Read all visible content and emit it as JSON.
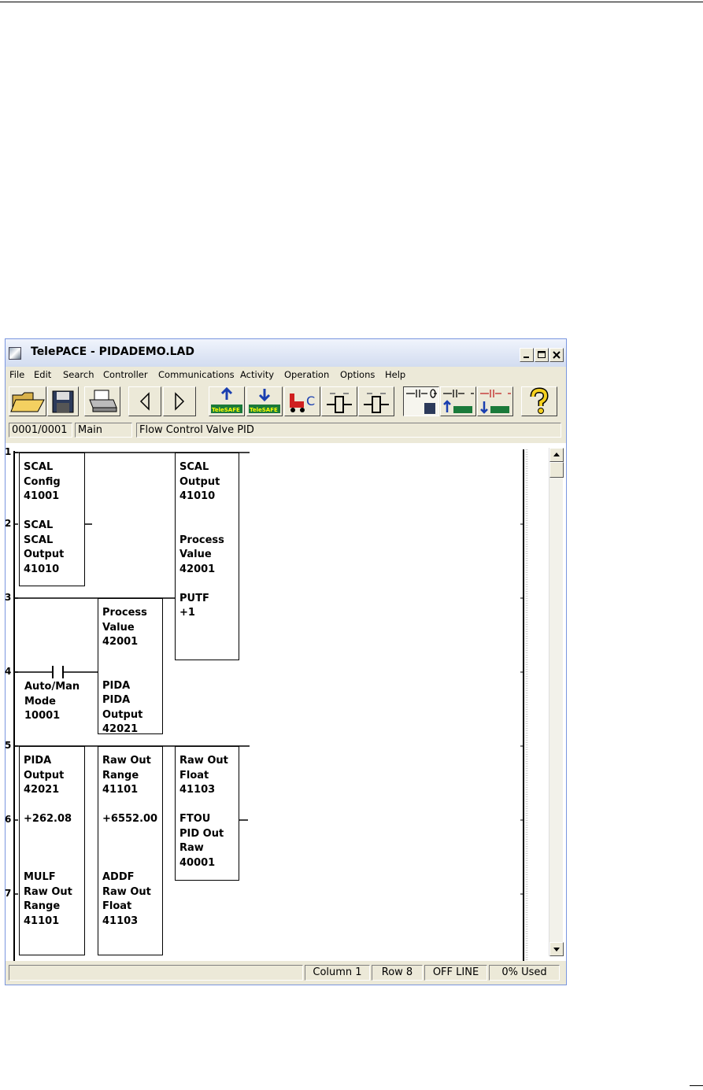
{
  "window": {
    "title": "TelePACE - PIDADEMO.LAD"
  },
  "menu": [
    "File",
    "Edit",
    "Search",
    "Controller",
    "Communications",
    "Activity",
    "Operation",
    "Options",
    "Help"
  ],
  "toolbar": {
    "telesafe_label": "TeleSAFE",
    "icons": [
      "open-folder-icon",
      "save-disk-icon",
      "print-icon",
      "back-arrow-icon",
      "forward-arrow-icon",
      "read-from-controller-icon",
      "write-to-controller-icon",
      "run-controller-icon",
      "monitor-icon",
      "monitor-alt-icon",
      "ladder-save-icon",
      "ladder-read-icon",
      "ladder-write-icon",
      "help-icon"
    ],
    "controller_c_label": "C"
  },
  "infobar": {
    "network": "0001/0001",
    "name": "Main",
    "comment": "Flow Control Valve PID"
  },
  "ladder": {
    "rung_numbers": [
      "1",
      "2",
      "3",
      "4",
      "5",
      "6",
      "7"
    ],
    "blocks": [
      {
        "id": "scal-config",
        "text": "SCAL\nConfig\n41001\n\nSCAL\nSCAL\nOutput\n41010"
      },
      {
        "id": "scal-output",
        "text": "SCAL\nOutput\n41010\n\n\nProcess\nValue\n42001\n\nPUTF\n+1"
      },
      {
        "id": "pida",
        "text": "Process\nValue\n42001\n\n\nPIDA\nPIDA\nOutput\n42021"
      },
      {
        "id": "mulf",
        "text": "PIDA\nOutput\n42021\n\n+262.08\n\n\n\nMULF\nRaw Out\nRange\n41101"
      },
      {
        "id": "addf",
        "text": "Raw Out\nRange\n41101\n\n+6552.00\n\n\n\nADDF\nRaw Out\nFloat\n41103"
      },
      {
        "id": "ftou",
        "text": "Raw Out\nFloat\n41103\n\nFTOU\nPID Out\nRaw\n40001"
      }
    ],
    "contact_label": "Auto/Man\nMode\n10001"
  },
  "status": {
    "blank": "",
    "column": "Column 1",
    "row": "Row 8",
    "mode": "OFF LINE",
    "used": "0% Used"
  },
  "colors": {
    "window_bg": "#ece9d8",
    "title_gradient": "#d2dcf0",
    "telesafe_green": "#1a7a3a"
  }
}
